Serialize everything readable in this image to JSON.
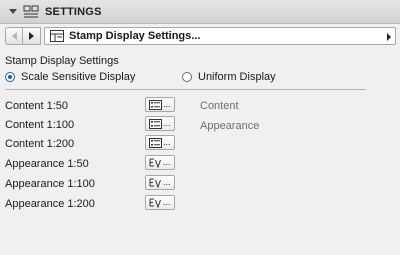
{
  "header": {
    "title": "SETTINGS",
    "icon": "settings-panel-icon"
  },
  "nav": {
    "prev_icon": "chevron-left-icon",
    "next_icon": "chevron-right-icon",
    "selector_icon": "stamp-settings-icon",
    "selector_label": "Stamp Display Settings...",
    "selector_arrow_icon": "submenu-arrow-icon"
  },
  "section": {
    "title": "Stamp Display Settings"
  },
  "display_mode": {
    "options": [
      {
        "label": "Scale Sensitive Display",
        "selected": true
      },
      {
        "label": "Uniform Display",
        "selected": false
      }
    ]
  },
  "rows": [
    {
      "label": "Content 1:50",
      "icon": "list-settings-icon",
      "button_text": "..."
    },
    {
      "label": "Content 1:100",
      "icon": "list-settings-icon",
      "button_text": "..."
    },
    {
      "label": "Content 1:200",
      "icon": "list-settings-icon",
      "button_text": "..."
    },
    {
      "label": "Appearance 1:50",
      "icon": "appearance-settings-icon",
      "button_text": "..."
    },
    {
      "label": "Appearance 1:100",
      "icon": "appearance-settings-icon",
      "button_text": "..."
    },
    {
      "label": "Appearance 1:200",
      "icon": "appearance-settings-icon",
      "button_text": "..."
    }
  ],
  "side_labels": [
    "Content",
    "Appearance"
  ],
  "colors": {
    "accent": "#1c5fa8",
    "header_bg": "#d8d8d8",
    "panel_bg": "#f0f0f0"
  }
}
